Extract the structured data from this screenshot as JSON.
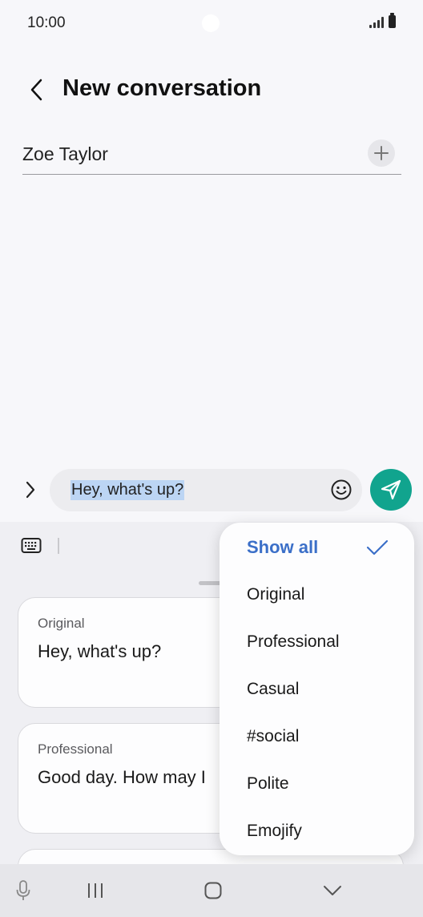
{
  "status_bar": {
    "time": "10:00"
  },
  "header": {
    "title": "New conversation"
  },
  "recipient": {
    "name": "Zoe Taylor"
  },
  "composer": {
    "message_text": "Hey, what's up?"
  },
  "suggestions": [
    {
      "label": "Original",
      "text": "Hey, what's up?"
    },
    {
      "label": "Professional",
      "text": "Good day. How may I"
    }
  ],
  "tone_menu": {
    "items": [
      {
        "label": "Show all",
        "selected": true
      },
      {
        "label": "Original",
        "selected": false
      },
      {
        "label": "Professional",
        "selected": false
      },
      {
        "label": "Casual",
        "selected": false
      },
      {
        "label": "#social",
        "selected": false
      },
      {
        "label": "Polite",
        "selected": false
      },
      {
        "label": "Emojify",
        "selected": false
      }
    ]
  },
  "colors": {
    "accent": "#3b6fc8",
    "send_button": "#11a48e",
    "selection": "#bcd5f4"
  },
  "icons": [
    "back-arrow-icon",
    "plus-icon",
    "chevron-right-icon",
    "emoji-icon",
    "send-icon",
    "keyboard-icon",
    "checkmark-icon",
    "microphone-icon",
    "recents-icon",
    "home-icon",
    "hide-keyboard-icon"
  ]
}
